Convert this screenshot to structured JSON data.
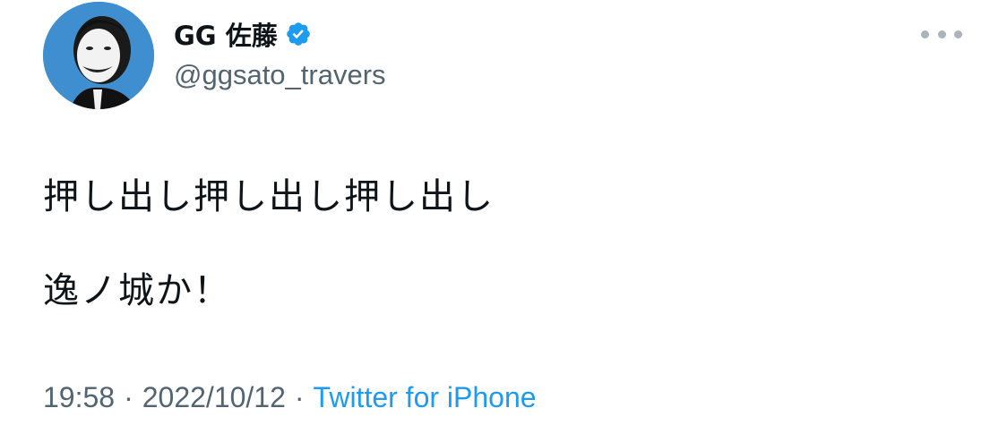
{
  "tweet": {
    "author": {
      "display_name": "GG 佐藤",
      "handle": "@ggsato_travers",
      "verified": true,
      "avatar": "profile-photo"
    },
    "text_lines": [
      "押し出し押し出し押し出し",
      "逸ノ城か！"
    ],
    "time": "19:58",
    "date": "2022/10/12",
    "separator": "·",
    "source": "Twitter for iPhone",
    "more_icon": "more-horizontal-icon"
  },
  "colors": {
    "text": "#0f1419",
    "secondary": "#536471",
    "link": "#1d9bf0",
    "verified_badge": "#1d9bf0",
    "avatar_bg": "#3f8ed0"
  }
}
